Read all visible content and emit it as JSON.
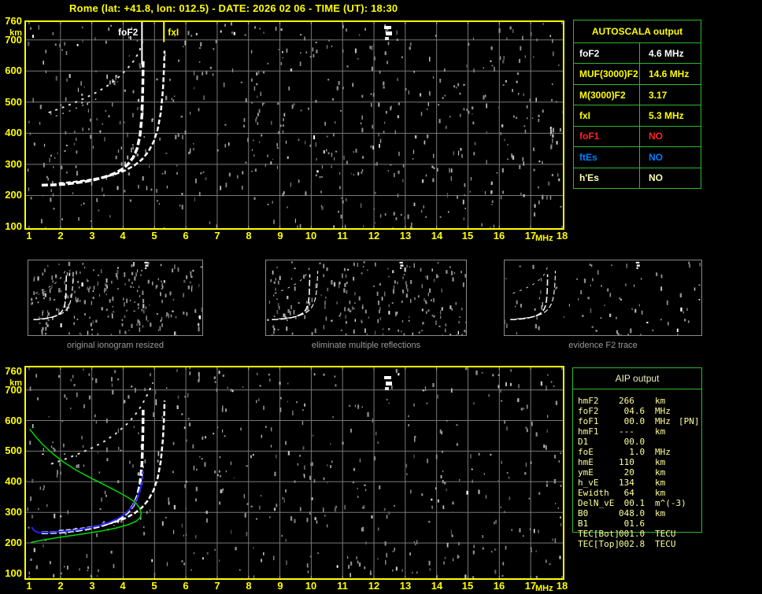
{
  "window": {
    "title": "Rome (lat: +41.8, lon: 012.5) - DATE: 2026 02 06 - TIME (UT): 18:30"
  },
  "colors": {
    "accent_yellow": "#ffff00",
    "table_border_green": "#2eb82e",
    "trace_white": "#ffffff",
    "fitted_trace_blue": "#2222ff",
    "profile_green": "#00d800",
    "grid_gray": "#787878",
    "noise_gray": "#909090",
    "caption_gray": "#9a9a9a",
    "aip_text": "#ffff99",
    "foF1_red": "#ff2222",
    "ftEs_blue": "#0080ff",
    "hEs_pale": "#ffffb0"
  },
  "autoscala": {
    "header": "AUTOSCALA output",
    "rows": [
      {
        "param": "foF2",
        "value": "4.6 MHz",
        "color": "#ffffff"
      },
      {
        "param": "MUF(3000)F2",
        "value": "14.6 MHz",
        "color": "#ffff00"
      },
      {
        "param": "M(3000)F2",
        "value": "3.17",
        "color": "#ffff00"
      },
      {
        "param": "fxI",
        "value": "5.3 MHz",
        "color": "#ffff00"
      },
      {
        "param": "foF1",
        "value": "NO",
        "color": "#ff2222"
      },
      {
        "param": "ftEs",
        "value": "NO",
        "color": "#0080ff"
      },
      {
        "param": "h'Es",
        "value": "NO",
        "color": "#ffffb0"
      }
    ]
  },
  "aip": {
    "header": "AIP output",
    "rows": [
      {
        "param": "hmF2",
        "value": "266",
        "unit": "km",
        "extra": ""
      },
      {
        "param": "foF2",
        "value": " 04.6",
        "unit": "MHz",
        "extra": ""
      },
      {
        "param": "foF1",
        "value": " 00.0",
        "unit": "MHz",
        "extra": "[PN]"
      },
      {
        "param": "hmF1",
        "value": "---",
        "unit": "km",
        "extra": ""
      },
      {
        "param": "D1",
        "value": " 00.0",
        "unit": "",
        "extra": ""
      },
      {
        "param": "foE",
        "value": "  1.0",
        "unit": "MHz",
        "extra": ""
      },
      {
        "param": "hmE",
        "value": "110",
        "unit": "km",
        "extra": ""
      },
      {
        "param": "ymE",
        "value": " 20",
        "unit": "km",
        "extra": ""
      },
      {
        "param": "h_vE",
        "value": "134",
        "unit": "km",
        "extra": ""
      },
      {
        "param": "Ewidth",
        "value": " 64",
        "unit": "km",
        "extra": ""
      },
      {
        "param": "DelN_vE",
        "value": " 00.1",
        "unit": "m^(-3)",
        "extra": ""
      },
      {
        "param": "B0",
        "value": "048.0",
        "unit": "km",
        "extra": ""
      },
      {
        "param": "B1",
        "value": " 01.6",
        "unit": "",
        "extra": ""
      },
      {
        "param": "TEC[Bot]",
        "value": "001.0",
        "unit": "TECU",
        "extra": ""
      },
      {
        "param": "TEC[Top]",
        "value": "002.8",
        "unit": "TECU",
        "extra": ""
      }
    ]
  },
  "thumbnails": [
    {
      "caption": "original ionogram resized",
      "series": [
        0,
        1,
        2,
        3
      ],
      "noise": 235,
      "seed": 101
    },
    {
      "caption": "eliminate multiple reflections",
      "series": [
        0,
        1,
        2
      ],
      "noise": 215,
      "seed": 202
    },
    {
      "caption": "evidence F2 trace",
      "series": [
        0,
        1,
        2
      ],
      "noise": 85,
      "seed": 303
    }
  ],
  "chart_data": [
    {
      "type": "scatter",
      "title": "ionogram with autoscaled critical frequencies",
      "xlabel": "MHz",
      "ylabel": "km",
      "xlim": [
        1,
        18
      ],
      "ylim": [
        100,
        760
      ],
      "x_ticks": [
        1,
        2,
        3,
        4,
        5,
        6,
        7,
        8,
        9,
        10,
        11,
        12,
        13,
        14,
        15,
        16,
        17,
        18
      ],
      "y_ticks": [
        760,
        700,
        600,
        500,
        400,
        300,
        200,
        100
      ],
      "grid": true,
      "series": [
        {
          "name": "F2 ordinary trace",
          "color": "#ffffff",
          "w": 3.5,
          "dash": "8 3",
          "points": [
            [
              1.4,
              233
            ],
            [
              1.75,
              234
            ],
            [
              2.1,
              236
            ],
            [
              2.45,
              240
            ],
            [
              2.8,
              245
            ],
            [
              3.1,
              251
            ],
            [
              3.4,
              259
            ],
            [
              3.7,
              270
            ],
            [
              3.95,
              283
            ],
            [
              4.15,
              300
            ],
            [
              4.32,
              322
            ],
            [
              4.45,
              352
            ],
            [
              4.54,
              395
            ],
            [
              4.6,
              460
            ],
            [
              4.63,
              560
            ],
            [
              4.64,
              635
            ]
          ]
        },
        {
          "name": "F2 extraordinary trace",
          "color": "#ffffff",
          "w": 2.5,
          "dash": "6 3",
          "points": [
            [
              1.95,
              239
            ],
            [
              2.4,
              243
            ],
            [
              2.85,
              249
            ],
            [
              3.3,
              257
            ],
            [
              3.7,
              267
            ],
            [
              4.05,
              280
            ],
            [
              4.35,
              296
            ],
            [
              4.6,
              316
            ],
            [
              4.8,
              340
            ],
            [
              4.97,
              372
            ],
            [
              5.1,
              412
            ],
            [
              5.2,
              465
            ],
            [
              5.27,
              540
            ],
            [
              5.31,
              620
            ],
            [
              5.32,
              665
            ]
          ]
        },
        {
          "name": "second hop reflection",
          "color": "#e0e0e0",
          "w": 2,
          "dash": "3 6",
          "points": [
            [
              1.62,
              466
            ],
            [
              2.0,
              480
            ],
            [
              2.4,
              496
            ],
            [
              2.8,
              514
            ],
            [
              3.2,
              534
            ],
            [
              3.55,
              556
            ],
            [
              3.85,
              580
            ],
            [
              4.12,
              606
            ],
            [
              4.35,
              634
            ],
            [
              4.52,
              664
            ],
            [
              4.62,
              696
            ]
          ]
        },
        {
          "name": "second hop faint branch",
          "color": "#aaaaaa",
          "w": 1.5,
          "dash": "2 7",
          "points": [
            [
              1.85,
              455
            ],
            [
              2.25,
              470
            ],
            [
              2.65,
              487
            ],
            [
              3.0,
              503
            ],
            [
              3.3,
              518
            ]
          ]
        }
      ],
      "markers": [
        {
          "label": "foF2",
          "x": 4.6,
          "color": "#ffffff",
          "to_km": 620,
          "side": "left"
        },
        {
          "label": "fxI",
          "x": 5.3,
          "color": "#ffff00",
          "to_km": 693,
          "side": "right"
        }
      ]
    },
    {
      "type": "scatter",
      "title": "ionogram with fitted trace and electron density profile",
      "xlabel": "MHz",
      "ylabel": "km",
      "xlim": [
        1,
        18
      ],
      "ylim": [
        100,
        760
      ],
      "x_ticks": [
        1,
        2,
        3,
        4,
        5,
        6,
        7,
        8,
        9,
        10,
        11,
        12,
        13,
        14,
        15,
        16,
        17,
        18
      ],
      "y_ticks": [
        760,
        700,
        600,
        500,
        400,
        300,
        200,
        100
      ],
      "grid": true,
      "series": [
        {
          "name": "F2 ordinary trace",
          "color": "#ffffff",
          "w": 3.5,
          "dash": "8 3",
          "points": [
            [
              1.4,
              233
            ],
            [
              1.75,
              234
            ],
            [
              2.1,
              236
            ],
            [
              2.45,
              240
            ],
            [
              2.8,
              245
            ],
            [
              3.1,
              251
            ],
            [
              3.4,
              259
            ],
            [
              3.7,
              270
            ],
            [
              3.95,
              283
            ],
            [
              4.15,
              300
            ],
            [
              4.32,
              322
            ],
            [
              4.45,
              352
            ],
            [
              4.54,
              395
            ],
            [
              4.6,
              460
            ],
            [
              4.63,
              560
            ],
            [
              4.64,
              635
            ]
          ]
        },
        {
          "name": "F2 extraordinary trace",
          "color": "#ffffff",
          "w": 2.5,
          "dash": "6 3",
          "points": [
            [
              1.95,
              239
            ],
            [
              2.4,
              243
            ],
            [
              2.85,
              249
            ],
            [
              3.3,
              257
            ],
            [
              3.7,
              267
            ],
            [
              4.05,
              280
            ],
            [
              4.35,
              296
            ],
            [
              4.6,
              316
            ],
            [
              4.8,
              340
            ],
            [
              4.97,
              372
            ],
            [
              5.1,
              412
            ],
            [
              5.2,
              465
            ],
            [
              5.27,
              540
            ],
            [
              5.31,
              620
            ],
            [
              5.32,
              665
            ]
          ]
        },
        {
          "name": "second hop reflection",
          "color": "#e0e0e0",
          "w": 2,
          "dash": "3 6",
          "points": [
            [
              1.7,
              458
            ],
            [
              2.1,
              472
            ],
            [
              2.55,
              490
            ],
            [
              3.0,
              510
            ],
            [
              3.4,
              532
            ],
            [
              3.75,
              556
            ],
            [
              4.08,
              584
            ],
            [
              4.35,
              614
            ],
            [
              4.58,
              648
            ],
            [
              4.78,
              686
            ],
            [
              4.95,
              724
            ]
          ]
        },
        {
          "name": "fitted trace",
          "color": "#2222ff",
          "w": 2,
          "dash": "",
          "points": [
            [
              1.08,
              252
            ],
            [
              1.16,
              240
            ],
            [
              1.3,
              234
            ],
            [
              1.6,
              234
            ],
            [
              2.0,
              237
            ],
            [
              2.4,
              241
            ],
            [
              2.8,
              247
            ],
            [
              3.2,
              256
            ],
            [
              3.55,
              267
            ],
            [
              3.85,
              281
            ],
            [
              4.1,
              298
            ],
            [
              4.3,
              320
            ],
            [
              4.45,
              348
            ],
            [
              4.55,
              378
            ],
            [
              4.6,
              400
            ]
          ]
        },
        {
          "name": "fitted trace endpoint dots",
          "color": "#3333ff",
          "dots": true,
          "points": [
            [
              4.59,
              393
            ],
            [
              4.61,
              412
            ],
            [
              4.63,
              430
            ]
          ]
        },
        {
          "name": "electron density profile",
          "color": "#00d800",
          "w": 1.5,
          "dash": "",
          "points": [
            [
              1.02,
              572
            ],
            [
              1.2,
              548
            ],
            [
              1.45,
              520
            ],
            [
              1.75,
              492
            ],
            [
              2.1,
              464
            ],
            [
              2.5,
              438
            ],
            [
              2.95,
              413
            ],
            [
              3.4,
              390
            ],
            [
              3.8,
              369
            ],
            [
              4.15,
              349
            ],
            [
              4.4,
              331
            ],
            [
              4.53,
              313
            ],
            [
              4.57,
              298
            ],
            [
              4.55,
              284
            ],
            [
              4.42,
              271
            ],
            [
              4.15,
              259
            ],
            [
              3.75,
              248
            ],
            [
              3.25,
              238
            ],
            [
              2.7,
              229
            ],
            [
              2.15,
              221
            ],
            [
              1.65,
              213
            ],
            [
              1.3,
              207
            ],
            [
              1.05,
              201
            ]
          ]
        }
      ],
      "markers": []
    }
  ],
  "render": {
    "top_plot": {
      "seed": 7,
      "noise": 620
    },
    "bottom_plot": {
      "seed": 13,
      "noise": 520
    }
  }
}
